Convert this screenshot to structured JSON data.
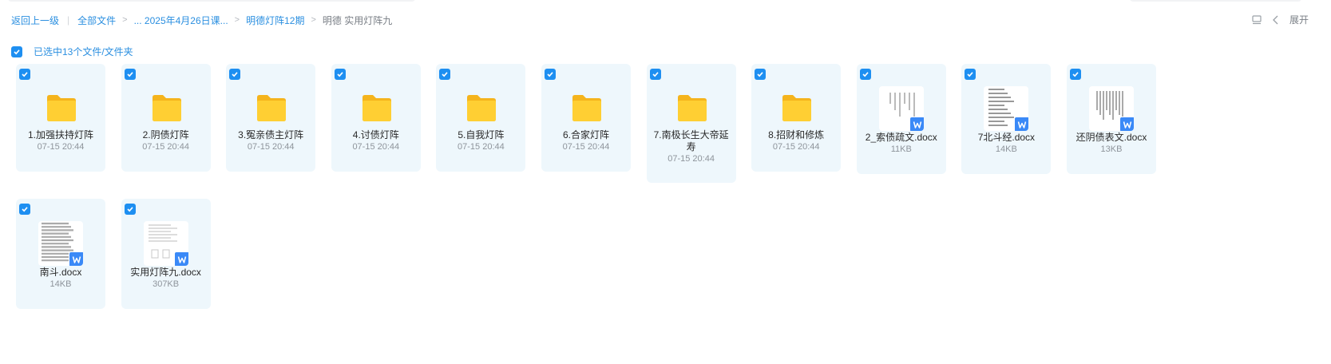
{
  "breadcrumb": {
    "back": "返回上一级",
    "all_files": "全部文件",
    "folder_1": "... 2025年4月26日课...",
    "folder_2": "明德灯阵12期",
    "current": "明德 实用灯阵九"
  },
  "toolbar": {
    "expand_label": "展开"
  },
  "selection": {
    "text": "已选中13个文件/文件夹"
  },
  "colors": {
    "accent": "#1e8ff1",
    "card_bg": "#eef7fc",
    "folder": "#ffc928",
    "word_badge": "#3a89f7"
  },
  "items": [
    {
      "type": "folder",
      "name": "1.加强扶持灯阵",
      "meta": "07-15 20:44",
      "checked": true
    },
    {
      "type": "folder",
      "name": "2.阴债灯阵",
      "meta": "07-15 20:44",
      "checked": true
    },
    {
      "type": "folder",
      "name": "3.冤亲债主灯阵",
      "meta": "07-15 20:44",
      "checked": true
    },
    {
      "type": "folder",
      "name": "4.讨债灯阵",
      "meta": "07-15 20:44",
      "checked": true
    },
    {
      "type": "folder",
      "name": "5.自我灯阵",
      "meta": "07-15 20:44",
      "checked": true
    },
    {
      "type": "folder",
      "name": "6.合家灯阵",
      "meta": "07-15 20:44",
      "checked": true
    },
    {
      "type": "folder",
      "name": "7.南极长生大帝延寿",
      "meta": "07-15 20:44",
      "checked": true
    },
    {
      "type": "folder",
      "name": "8.招财和修炼",
      "meta": "07-15 20:44",
      "checked": true
    },
    {
      "type": "docx",
      "name": "2_索债疏文.docx",
      "meta": "11KB",
      "checked": true
    },
    {
      "type": "docx",
      "name": "7北斗经.docx",
      "meta": "14KB",
      "checked": true
    },
    {
      "type": "docx",
      "name": "还阴债表文.docx",
      "meta": "13KB",
      "checked": true
    },
    {
      "type": "docx",
      "name": "南斗.docx",
      "meta": "14KB",
      "checked": true
    },
    {
      "type": "docx",
      "name": "实用灯阵九.docx",
      "meta": "307KB",
      "checked": true
    }
  ]
}
